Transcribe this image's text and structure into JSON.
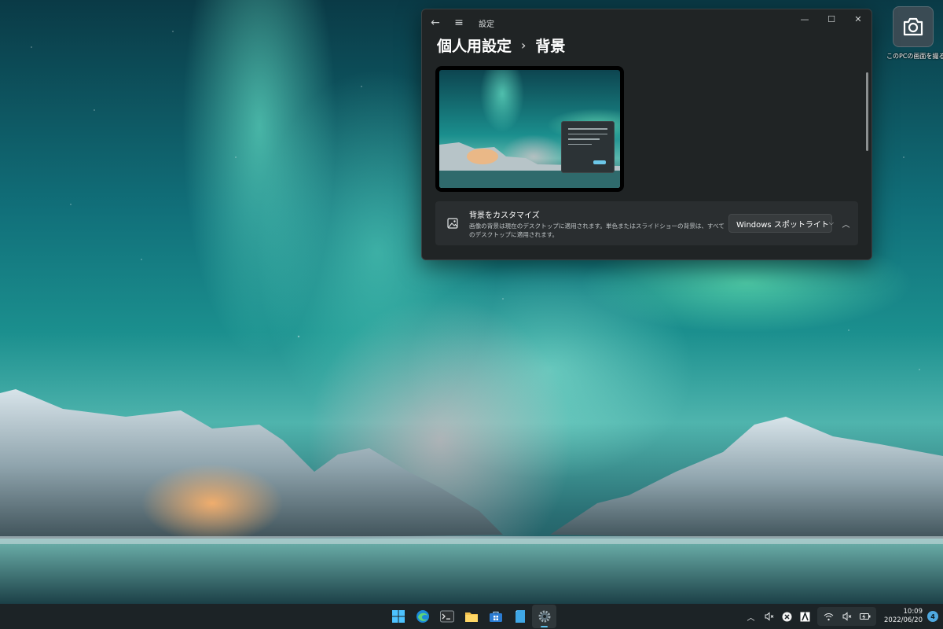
{
  "desktop": {
    "icon_label": "このPCの画面を撮る",
    "icon": "camera-icon"
  },
  "window": {
    "app_title": "設定",
    "breadcrumb_parent": "個人用設定",
    "breadcrumb_separator": "›",
    "breadcrumb_current": "背景",
    "controls": {
      "minimize": "—",
      "maximize": "☐",
      "close": "✕"
    },
    "back_icon": "←",
    "menu_icon": "≡"
  },
  "background_card": {
    "title": "背景をカスタマイズ",
    "description": "画像の背景は現在のデスクトップに適用されます。単色またはスライドショーの背景は、すべてのデスクトップに適用されます。",
    "dropdown_value": "Windows スポットライト",
    "dropdown_chevron": "⌵",
    "collapse_icon": "︿"
  },
  "taskbar": {
    "apps": [
      {
        "name": "start-button",
        "icon": "windows-logo-icon"
      },
      {
        "name": "edge-button",
        "icon": "edge-icon"
      },
      {
        "name": "terminal-button",
        "icon": "terminal-icon"
      },
      {
        "name": "file-explorer-button",
        "icon": "folder-icon"
      },
      {
        "name": "store-button",
        "icon": "store-icon"
      },
      {
        "name": "notepad-button",
        "icon": "document-icon"
      },
      {
        "name": "settings-button",
        "icon": "gear-icon",
        "active": true
      }
    ],
    "tray": {
      "chevron": "︿",
      "mute_glyph": "🔇",
      "clock_time": "10:09",
      "clock_date": "2022/06/20",
      "notification_count": "4"
    }
  },
  "colors": {
    "accent": "#5fbfe8",
    "window_bg": "#202425",
    "card_bg": "#2a2e30",
    "taskbar_bg": "#1c2326"
  }
}
